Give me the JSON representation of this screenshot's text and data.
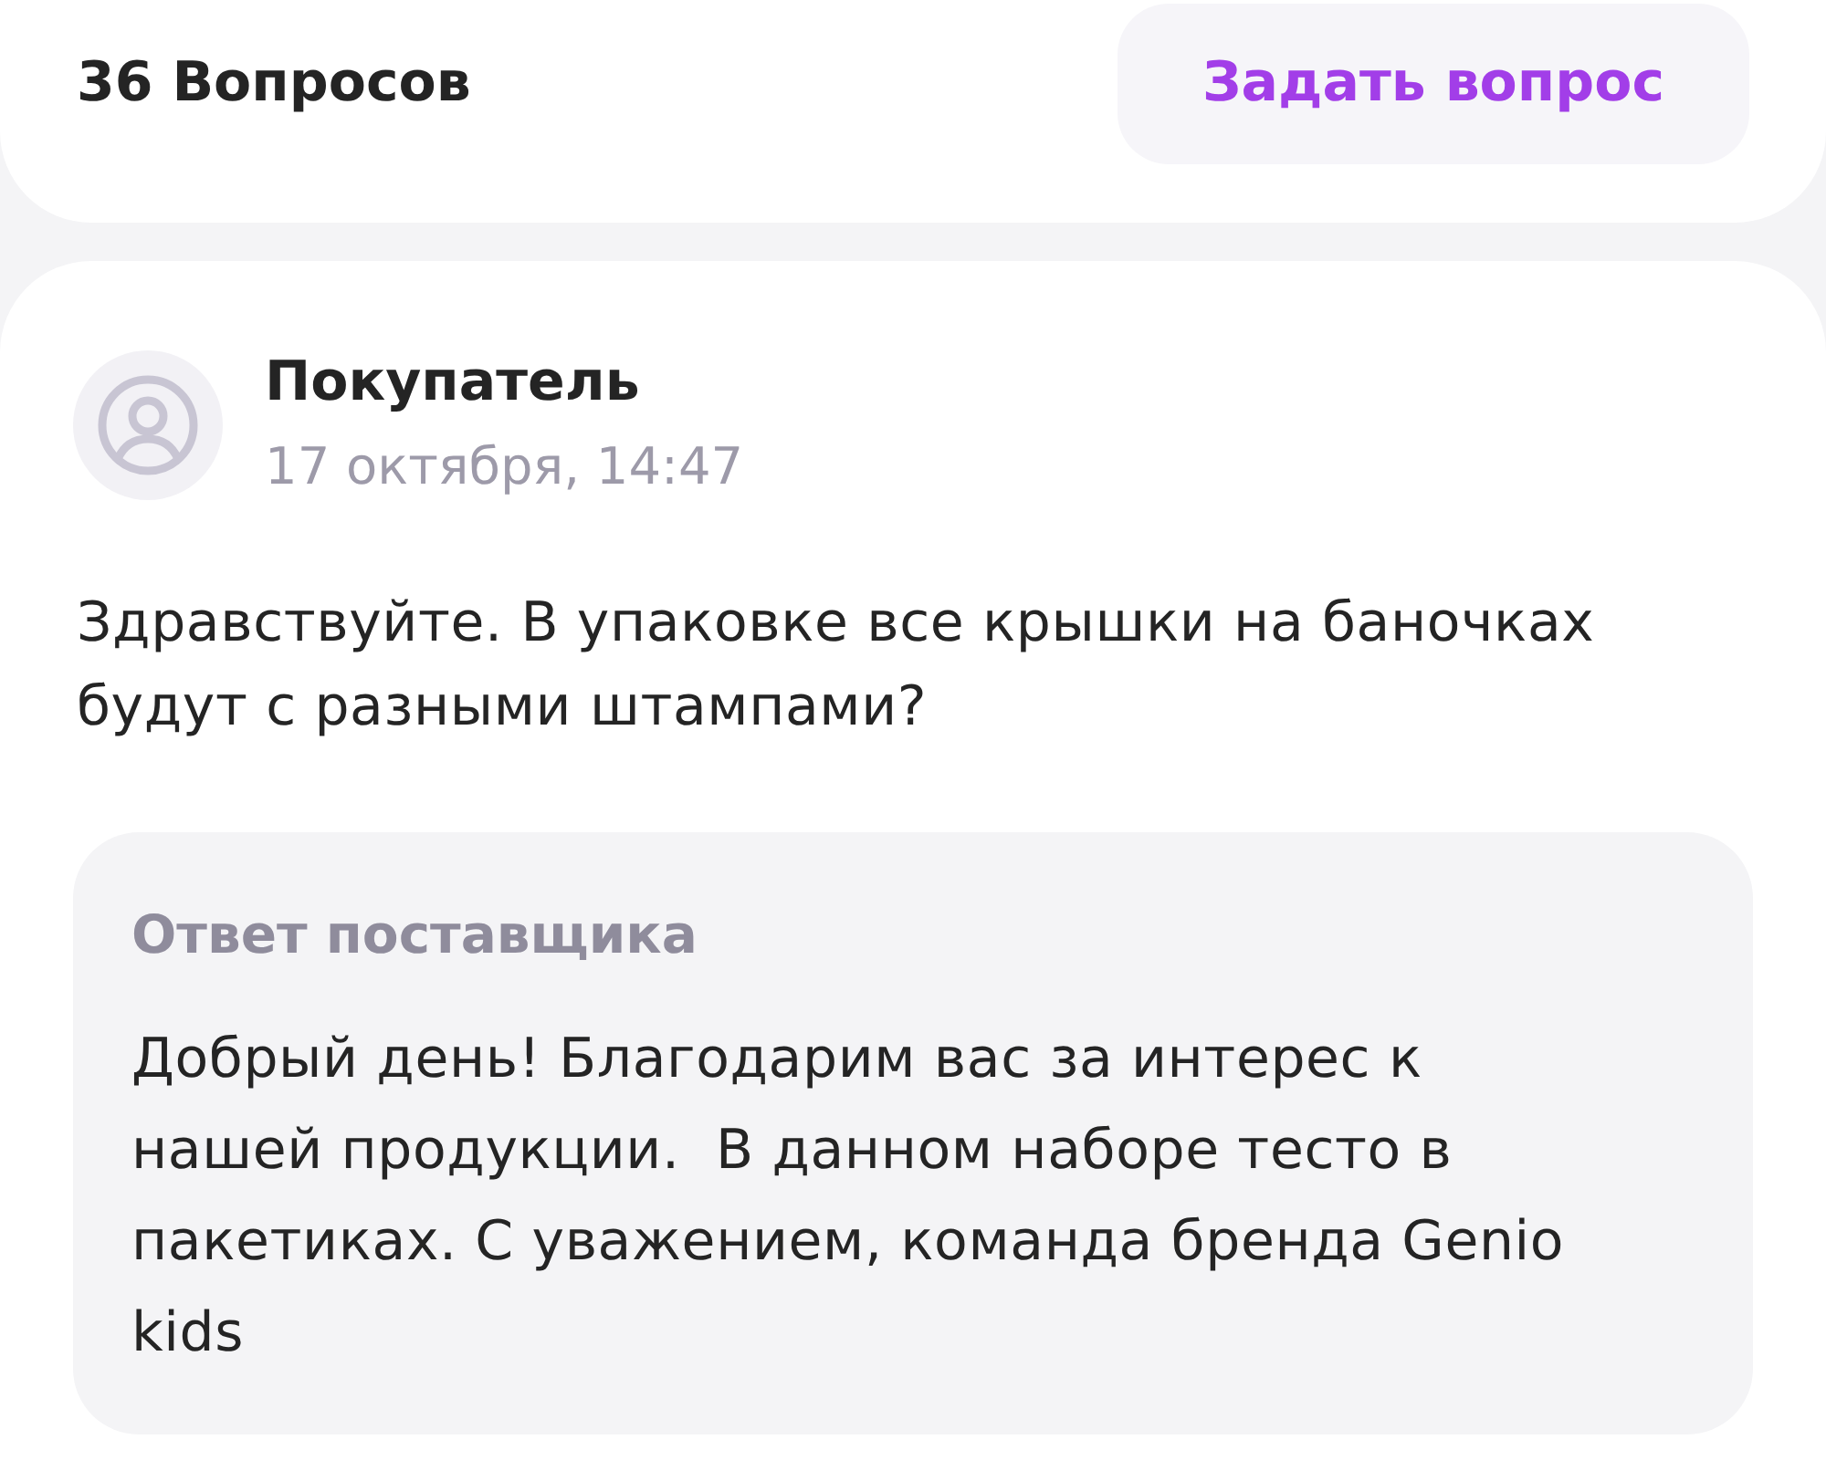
{
  "header": {
    "title": "36 Вопросов",
    "ask_button": "Задать вопрос"
  },
  "question": {
    "author": "Покупатель",
    "date": "17 октября, 14:47",
    "text": "Здравствуйте. В упаковке все крышки на баночках будут с разными штампами?"
  },
  "answer": {
    "title": "Ответ поставщика",
    "text": "Добрый день! Благодарим вас за интерес к нашей продукции.  В данном наборе тесто в пакетиках. С уважением, команда бренда Genio kids"
  }
}
